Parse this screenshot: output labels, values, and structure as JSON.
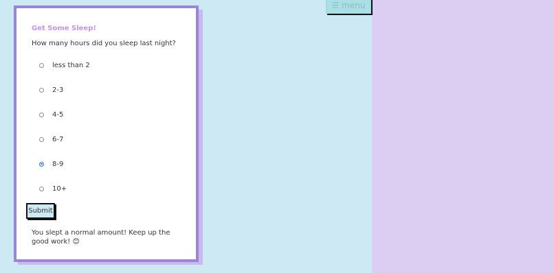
{
  "menu": {
    "label": "☰ menu"
  },
  "form": {
    "title": "Get Some Sleep!",
    "question": "How many hours did you sleep last night?",
    "options": [
      {
        "label": "less than 2",
        "checked": false
      },
      {
        "label": "2-3",
        "checked": false
      },
      {
        "label": "4-5",
        "checked": false
      },
      {
        "label": "6-7",
        "checked": false
      },
      {
        "label": "8-9",
        "checked": true
      },
      {
        "label": "10+",
        "checked": false
      }
    ],
    "submit_label": "Submit",
    "result": "You slept a normal amount! Keep up the good work! 😊"
  },
  "colors": {
    "background": "#cdeaf4",
    "right_panel": "#dccdf3",
    "card_border": "#9b86d6",
    "title": "#c493ea",
    "radio_checked": "#2f6fe0"
  }
}
